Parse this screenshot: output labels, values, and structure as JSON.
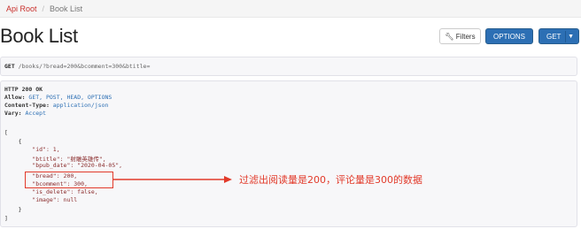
{
  "breadcrumb": {
    "root": "Api Root",
    "current": "Book List"
  },
  "page_title": "Book List",
  "buttons": {
    "filters": "Filters",
    "options": "OPTIONS",
    "get": "GET"
  },
  "request": {
    "method": "GET",
    "path": "/books/?bread=200&bcomment=300&btitle="
  },
  "response": {
    "status": "HTTP 200 OK",
    "headers": [
      {
        "name": "Allow:",
        "value": "GET, POST, HEAD, OPTIONS"
      },
      {
        "name": "Content-Type:",
        "value": "application/json"
      },
      {
        "name": "Vary:",
        "value": "Accept"
      }
    ],
    "body_lines": [
      "[",
      "    {",
      "        \"id\": 1,",
      "        \"btitle\": \"射雕英雄传\",",
      "        \"bpub_date\": \"2020-04-05\",",
      "        \"bread\": 200,",
      "        \"bcomment\": 300,",
      "        \"is_delete\": false,",
      "        \"image\": null",
      "    }",
      "]"
    ]
  },
  "annotation": "过滤出阅读量是200，评论量是300的数据",
  "colors": {
    "annotation": "#e23a2a",
    "primary_button": "#2c6fb4",
    "breadcrumb_link": "#c9302c"
  }
}
